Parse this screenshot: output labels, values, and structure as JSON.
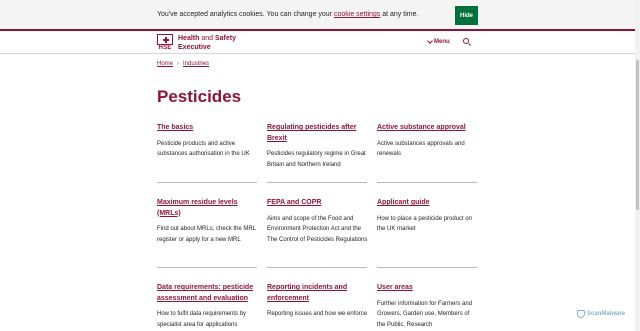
{
  "cookie_banner": {
    "text_before": "You've accepted analytics cookies. You can change your ",
    "link": "cookie settings",
    "text_after": " at any time.",
    "hide_label": "Hide"
  },
  "header": {
    "logo_text": "HSE",
    "brand_bold_1": "Health",
    "brand_thin": " and ",
    "brand_bold_2": "Safety",
    "brand_line2": "Executive",
    "menu_label": "Menu"
  },
  "breadcrumb": {
    "items": [
      "Home",
      "Industries"
    ],
    "separator": "›"
  },
  "page": {
    "title": "Pesticides"
  },
  "cards": [
    {
      "title": "The basics",
      "description": "Pesticide products and active substances authorisation in the UK"
    },
    {
      "title": "Regulating pesticides after Brexit",
      "description": "Pesticides regulatory regime in Great Britain and Northern Ireland"
    },
    {
      "title": "Active substance approval",
      "description": "Active substances approvals and renewals"
    },
    {
      "title": "Maximum residue levels (MRLs)",
      "description": "Find out about MRLs, check the MRL register or apply for a new MRL"
    },
    {
      "title": "FEPA and COPR",
      "description": "Aims and scope of the Food and Environment Protection Act and the The Control of Pesticides Regulations"
    },
    {
      "title": "Applicant guide",
      "description": "How to place a pesticide product on the UK market"
    },
    {
      "title": "Data requirements: pesticide assessment and evaluation",
      "description": "How to fulfil data requirements by specialist area for applications"
    },
    {
      "title": "Reporting incidents and enforcement",
      "description": "Reporting issues and how we enforce"
    },
    {
      "title": "User areas",
      "description": "Further information for Farmers and Growers, Garden use, Members of the Public, Research"
    }
  ],
  "watermark": {
    "text": "ScanMalware"
  },
  "colors": {
    "brand": "#8f1537",
    "hide_button": "#00703c",
    "text": "#1f1f1f"
  }
}
